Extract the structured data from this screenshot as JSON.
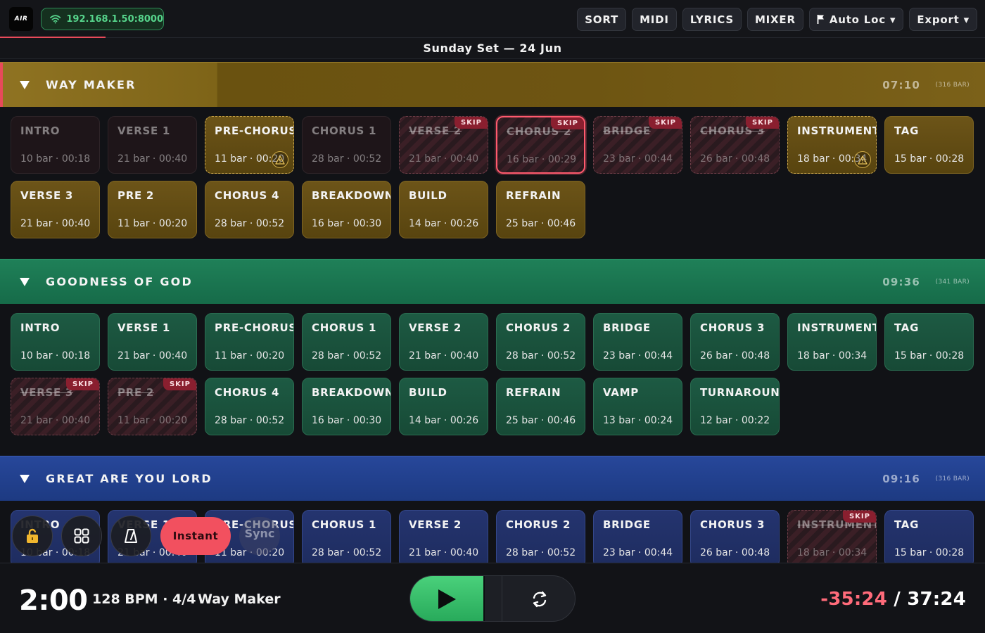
{
  "app": {
    "logo_text": "AIR"
  },
  "connection": {
    "address": "192.168.1.50:8000",
    "icon": "wifi-icon"
  },
  "toolbar": {
    "sort": "SORT",
    "midi": "MIDI",
    "lyrics": "LYRICS",
    "mixer": "MIXER",
    "auto_loc": "Auto Loc ▾",
    "export": "Export ▾"
  },
  "set_title": "Sunday Set — 24 Jun",
  "songs": [
    {
      "name": "WAY MAKER",
      "duration": "07:10",
      "bars": "(316 BAR)",
      "sections": [
        {
          "name": "INTRO",
          "info": "10 bar · 00:18",
          "state": "dim"
        },
        {
          "name": "VERSE 1",
          "info": "21 bar · 00:40",
          "state": "dim"
        },
        {
          "name": "PRE-CHORUS",
          "info": "11 bar · 00:20",
          "state": "warn"
        },
        {
          "name": "CHORUS 1",
          "info": "28 bar · 00:52",
          "state": "dim"
        },
        {
          "name": "VERSE 2",
          "info": "21 bar · 00:40",
          "state": "skip",
          "badge": "SKIP"
        },
        {
          "name": "CHORUS 2",
          "info": "16 bar · 00:29",
          "state": "skip-active",
          "badge": "SKIP"
        },
        {
          "name": "BRIDGE",
          "info": "23 bar · 00:44",
          "state": "skip",
          "badge": "SKIP"
        },
        {
          "name": "CHORUS 3",
          "info": "26 bar · 00:48",
          "state": "skip",
          "badge": "SKIP"
        },
        {
          "name": "INSTRUMENTAL",
          "info": "18 bar · 00:34",
          "state": "warn"
        },
        {
          "name": "TAG",
          "info": "15 bar · 00:28",
          "state": "normal"
        },
        {
          "name": "VERSE 3",
          "info": "21 bar · 00:40",
          "state": "normal"
        },
        {
          "name": "PRE 2",
          "info": "11 bar · 00:20",
          "state": "normal"
        },
        {
          "name": "CHORUS 4",
          "info": "28 bar · 00:52",
          "state": "normal"
        },
        {
          "name": "BREAKDOWN",
          "info": "16 bar · 00:30",
          "state": "normal"
        },
        {
          "name": "BUILD",
          "info": "14 bar · 00:26",
          "state": "normal"
        },
        {
          "name": "REFRAIN",
          "info": "25 bar · 00:46",
          "state": "normal"
        }
      ]
    },
    {
      "name": "GOODNESS OF GOD",
      "duration": "09:36",
      "bars": "(341 BAR)",
      "sections": [
        {
          "name": "INTRO",
          "info": "10 bar · 00:18",
          "state": "normal"
        },
        {
          "name": "VERSE 1",
          "info": "21 bar · 00:40",
          "state": "normal"
        },
        {
          "name": "PRE-CHORUS",
          "info": "11 bar · 00:20",
          "state": "normal"
        },
        {
          "name": "CHORUS 1",
          "info": "28 bar · 00:52",
          "state": "normal"
        },
        {
          "name": "VERSE 2",
          "info": "21 bar · 00:40",
          "state": "normal"
        },
        {
          "name": "CHORUS 2",
          "info": "28 bar · 00:52",
          "state": "normal"
        },
        {
          "name": "BRIDGE",
          "info": "23 bar · 00:44",
          "state": "normal"
        },
        {
          "name": "CHORUS 3",
          "info": "26 bar · 00:48",
          "state": "normal"
        },
        {
          "name": "INSTRUMENTAL",
          "info": "18 bar · 00:34",
          "state": "normal"
        },
        {
          "name": "TAG",
          "info": "15 bar · 00:28",
          "state": "normal"
        },
        {
          "name": "VERSE 3",
          "info": "21 bar · 00:40",
          "state": "skip",
          "badge": "SKIP"
        },
        {
          "name": "PRE 2",
          "info": "11 bar · 00:20",
          "state": "skip",
          "badge": "SKIP"
        },
        {
          "name": "CHORUS 4",
          "info": "28 bar · 00:52",
          "state": "normal"
        },
        {
          "name": "BREAKDOWN",
          "info": "16 bar · 00:30",
          "state": "normal"
        },
        {
          "name": "BUILD",
          "info": "14 bar · 00:26",
          "state": "normal"
        },
        {
          "name": "REFRAIN",
          "info": "25 bar · 00:46",
          "state": "normal"
        },
        {
          "name": "VAMP",
          "info": "13 bar · 00:24",
          "state": "normal"
        },
        {
          "name": "TURNAROUND",
          "info": "12 bar · 00:22",
          "state": "normal"
        }
      ]
    },
    {
      "name": "GREAT ARE YOU LORD",
      "duration": "09:16",
      "bars": "(316 BAR)",
      "sections": [
        {
          "name": "INTRO",
          "info": "10 bar · 00:18",
          "state": "normal"
        },
        {
          "name": "VERSE 1",
          "info": "21 bar · 00:40",
          "state": "normal"
        },
        {
          "name": "PRE-CHORUS",
          "info": "11 bar · 00:20",
          "state": "normal"
        },
        {
          "name": "CHORUS 1",
          "info": "28 bar · 00:52",
          "state": "normal"
        },
        {
          "name": "VERSE 2",
          "info": "21 bar · 00:40",
          "state": "normal"
        },
        {
          "name": "CHORUS 2",
          "info": "28 bar · 00:52",
          "state": "normal"
        },
        {
          "name": "BRIDGE",
          "info": "23 bar · 00:44",
          "state": "normal"
        },
        {
          "name": "CHORUS 3",
          "info": "26 bar · 00:48",
          "state": "normal"
        },
        {
          "name": "INSTRUMENTAL",
          "info": "18 bar · 00:34",
          "state": "skip",
          "badge": "SKIP"
        },
        {
          "name": "TAG",
          "info": "15 bar · 00:28",
          "state": "normal"
        }
      ]
    }
  ],
  "floating": {
    "lock_icon": "lock-icon",
    "grid_icon": "grid-icon",
    "metronome_icon": "metronome-icon",
    "instant_label": "Instant",
    "sync_label": "Sync"
  },
  "transport": {
    "clock": "2:00",
    "bpm": "128 BPM · 4/4",
    "current_song": "Way Maker",
    "remaining": "-35:24",
    "total": " / 37:24",
    "play_icon": "play-icon",
    "loop_icon": "loop-icon"
  },
  "colors": {
    "accent_red": "#f2505f",
    "play_green": "#3cc46f",
    "gold": "#7b6119",
    "green": "#1a7550",
    "blue": "#22408e"
  }
}
